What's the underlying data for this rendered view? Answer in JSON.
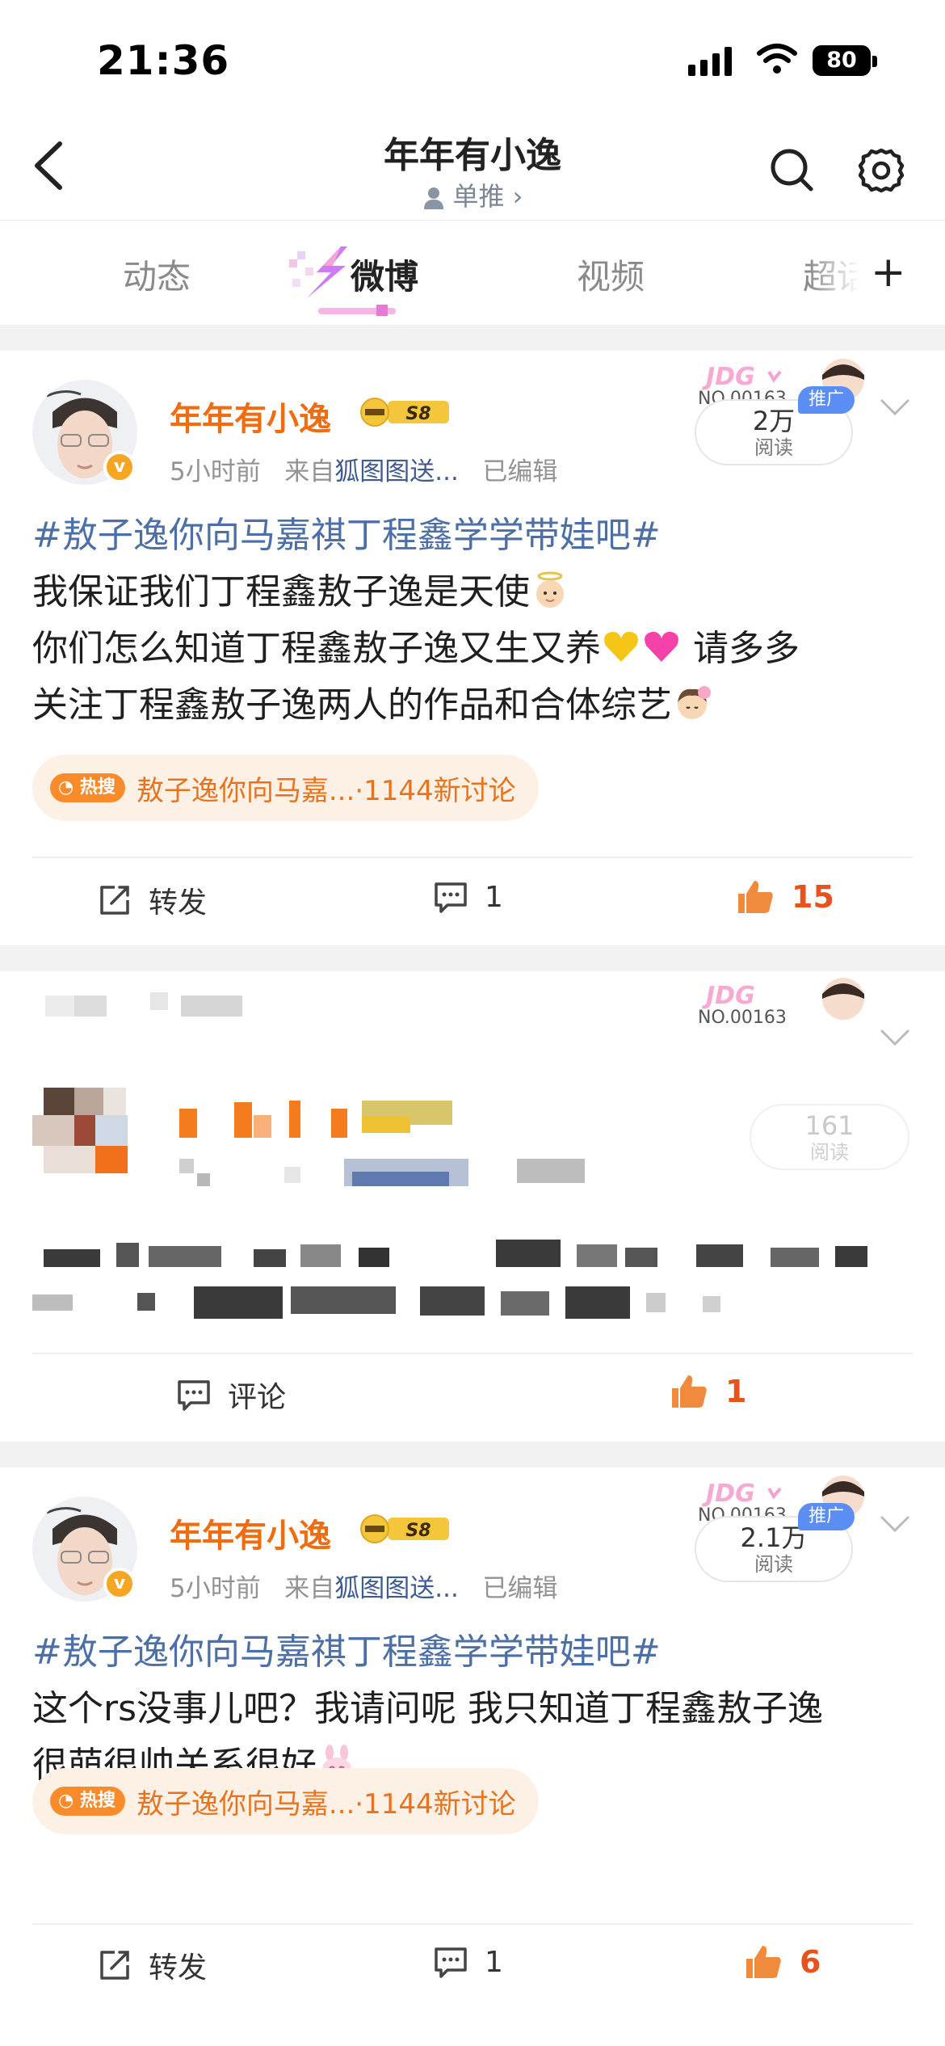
{
  "status_bar": {
    "time": "21:36",
    "battery": "80"
  },
  "header": {
    "title": "年年有小逸",
    "subtitle": "单推 ›"
  },
  "tabs": [
    {
      "label": "动态",
      "active": false
    },
    {
      "label": "微博",
      "active": true
    },
    {
      "label": "视频",
      "active": false
    },
    {
      "label": "超话",
      "active": false
    }
  ],
  "posts": [
    {
      "author": "年年有小逸",
      "level": "S8",
      "time": "5小时前",
      "from_prefix": "来自",
      "source": "狐图图送...",
      "edited": "已编辑",
      "badge_no": "NO.00163",
      "reads": "2万",
      "reads_label": "阅读",
      "promo": "推广",
      "topic": "#敖子逸你向马嘉祺丁程鑫学学带娃吧#",
      "lines": [
        "我保证我们丁程鑫敖子逸是天使",
        "你们怎么知道丁程鑫敖子逸又生又养",
        "请多多",
        "关注丁程鑫敖子逸两人的作品和合体综艺"
      ],
      "hot_tag": "热搜",
      "hot_text": "敖子逸你向马嘉...·1144新讨论",
      "repost_label": "转发",
      "comments": "1",
      "likes": "15"
    },
    {
      "badge_no": "NO.00163",
      "reads": "161",
      "reads_label": "阅读",
      "comment_label": "评论",
      "likes": "1"
    },
    {
      "author": "年年有小逸",
      "level": "S8",
      "time": "5小时前",
      "from_prefix": "来自",
      "source": "狐图图送...",
      "edited": "已编辑",
      "badge_no": "NO.00163",
      "reads": "2.1万",
      "reads_label": "阅读",
      "promo": "推广",
      "topic": "#敖子逸你向马嘉祺丁程鑫学学带娃吧#",
      "lines": [
        "这个rs没事儿吧？我请问呢 我只知道丁程鑫敖子逸",
        "很萌很帅关系很好"
      ],
      "hot_tag": "热搜",
      "hot_text": "敖子逸你向马嘉...·1144新讨论",
      "repost_label": "转发",
      "comments": "1",
      "likes": "6"
    }
  ],
  "colors": {
    "accent": "#f06c11",
    "link": "#4b6fa6",
    "like": "#e8521c",
    "hot_bg": "#fdf1e6"
  }
}
